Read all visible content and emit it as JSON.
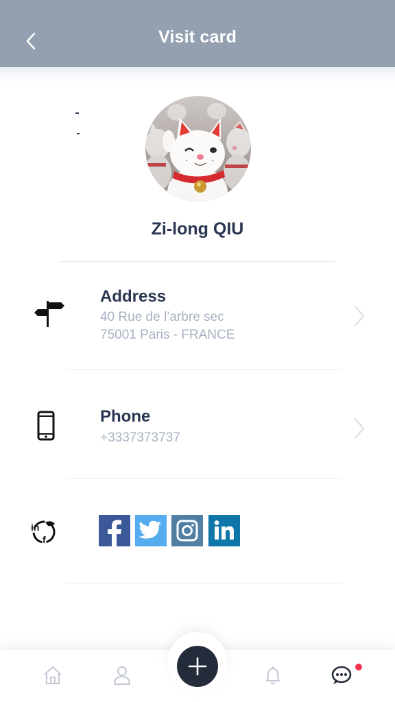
{
  "header": {
    "title": "Visit card"
  },
  "profile": {
    "name": "Zi-long QIU"
  },
  "address": {
    "label": "Address",
    "line1": "40 Rue de l’arbre sec",
    "line2": "75001 Paris - FRANCE"
  },
  "phone": {
    "label": "Phone",
    "number": "+3337373737"
  },
  "social": {
    "networks": [
      "facebook",
      "twitter",
      "instagram",
      "linkedin"
    ],
    "colors": {
      "facebook": "#3b5998",
      "twitter": "#55acee",
      "instagram": "#517fa4",
      "linkedin": "#0e76a8"
    }
  },
  "colors": {
    "header_bg": "#949fb0",
    "primary_text": "#2a3552",
    "secondary_text": "#a7b1c2",
    "fab": "#242b3a",
    "notification_badge": "#f0344e"
  },
  "nav": {
    "items": [
      "home-icon",
      "profile-icon",
      "add-icon",
      "bell-icon",
      "chat-icon"
    ]
  }
}
